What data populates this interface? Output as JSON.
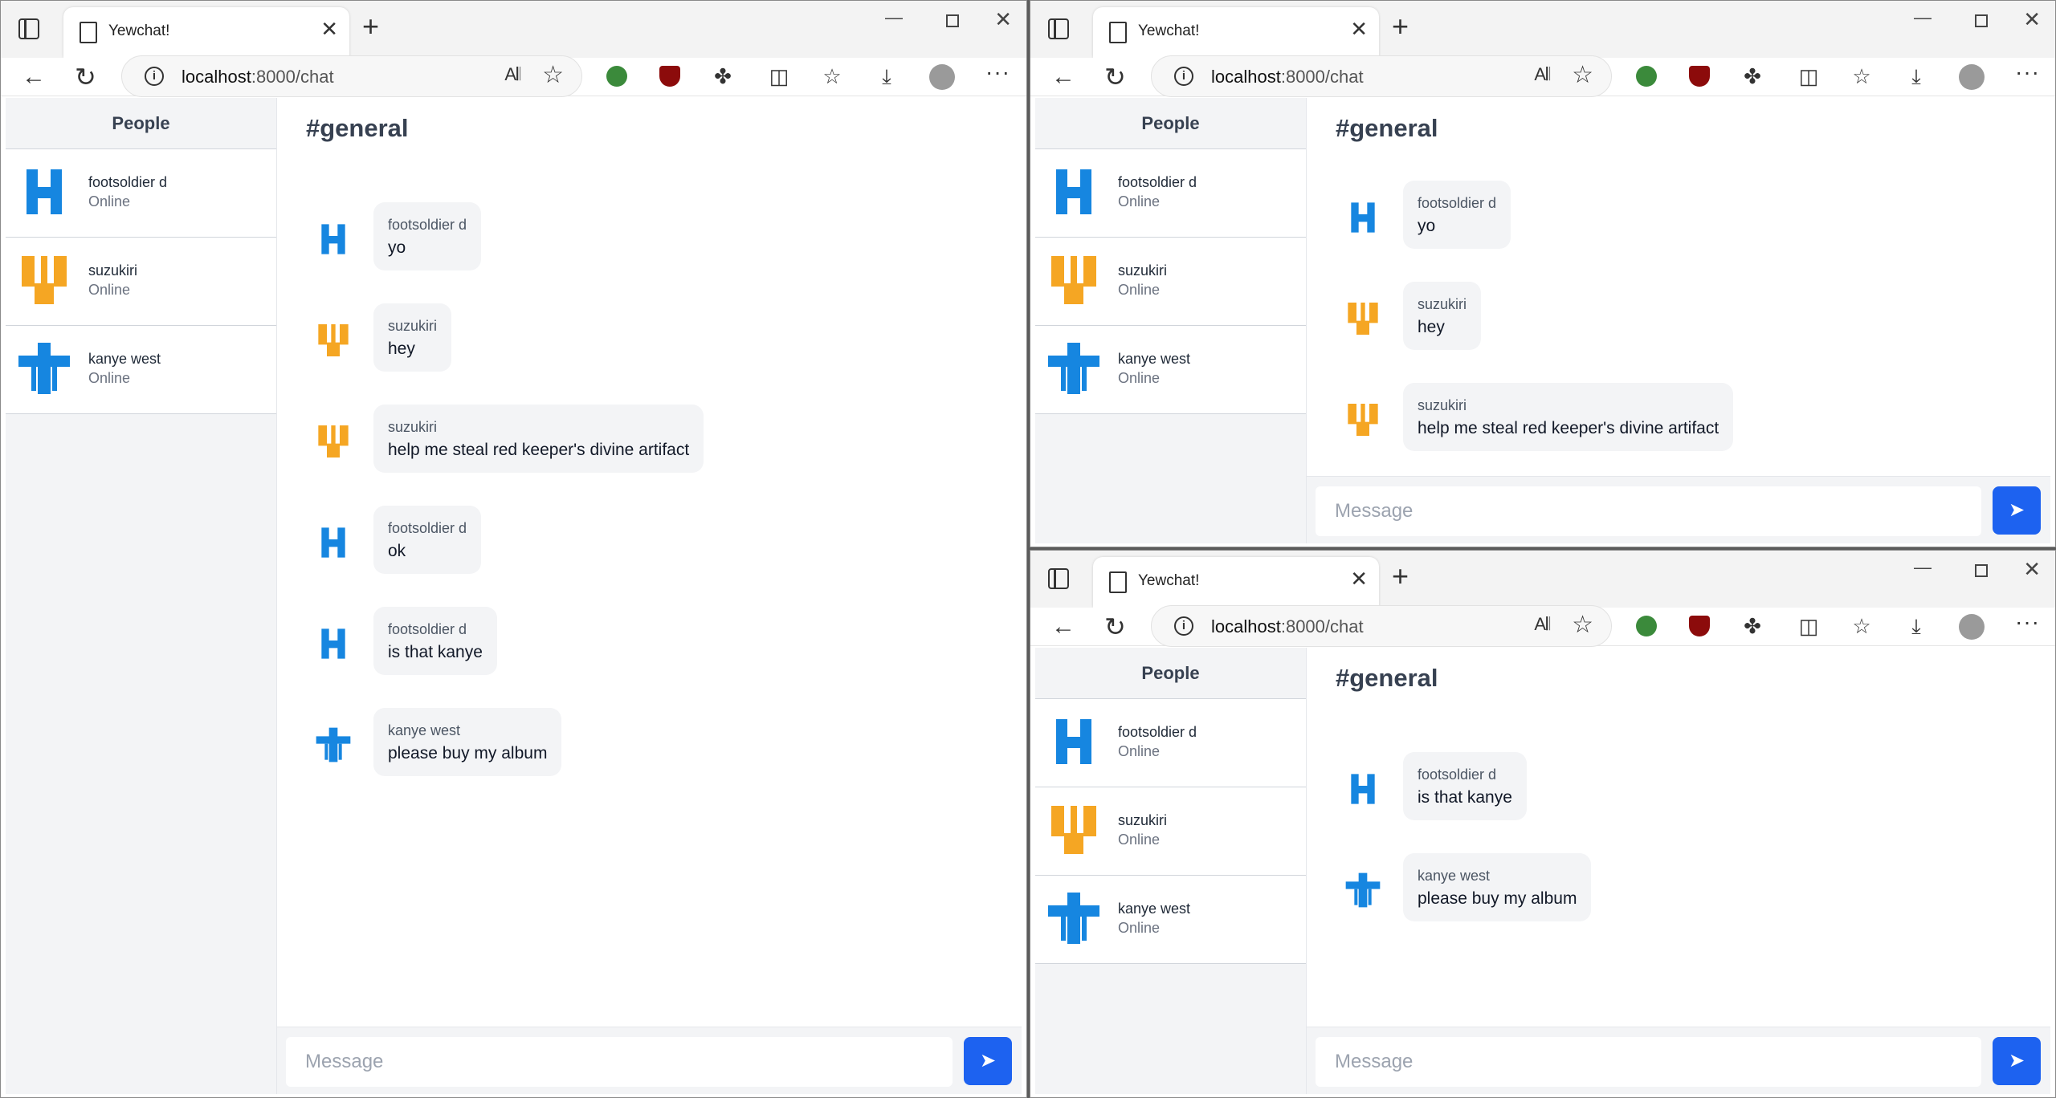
{
  "browser": {
    "tab_title": "Yewchat!",
    "url_host": "localhost",
    "url_path": ":8000/chat"
  },
  "sidebar": {
    "header": "People",
    "people": [
      {
        "name": "footsoldier d",
        "status": "Online",
        "avatar_color": "#1686e0"
      },
      {
        "name": "suzukiri",
        "status": "Online",
        "avatar_color": "#f5a623"
      },
      {
        "name": "kanye west",
        "status": "Online",
        "avatar_color": "#1686e0"
      }
    ]
  },
  "chat": {
    "channel": "#general",
    "placeholder": "Message",
    "send_icon": "send-icon",
    "accent": "#1d62f0"
  },
  "windows": [
    {
      "messages": [
        {
          "from": "footsoldier d",
          "text": "yo"
        },
        {
          "from": "suzukiri",
          "text": "hey"
        },
        {
          "from": "suzukiri",
          "text": "help me steal red keeper's divine artifact"
        },
        {
          "from": "footsoldier d",
          "text": "ok"
        },
        {
          "from": "footsoldier d",
          "text": "is that kanye"
        },
        {
          "from": "kanye west",
          "text": "please buy my album"
        }
      ]
    },
    {
      "messages": [
        {
          "from": "footsoldier d",
          "text": "yo"
        },
        {
          "from": "suzukiri",
          "text": "hey"
        },
        {
          "from": "suzukiri",
          "text": "help me steal red keeper's divine artifact"
        }
      ]
    },
    {
      "messages": [
        {
          "from": "footsoldier d",
          "text": "is that kanye"
        },
        {
          "from": "kanye west",
          "text": "please buy my album"
        }
      ]
    }
  ]
}
